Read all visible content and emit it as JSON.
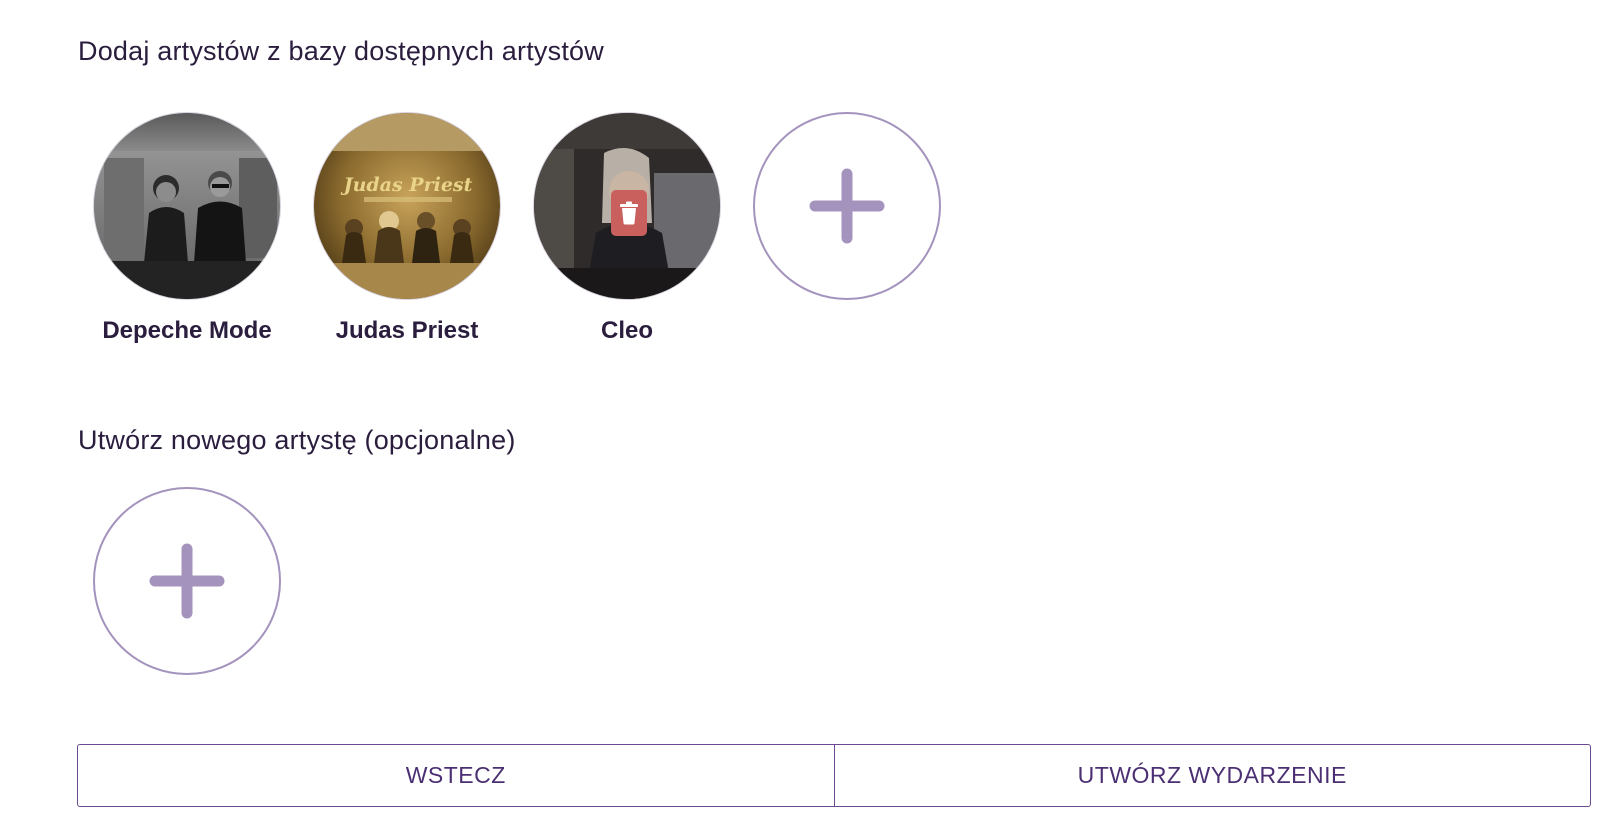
{
  "sections": {
    "existing_title": "Dodaj artystów z bazy dostępnych artystów",
    "new_title": "Utwórz nowego artystę (opcjonalne)"
  },
  "artists": [
    {
      "name": "Depeche Mode",
      "photo": "two-men-black-white-photo"
    },
    {
      "name": "Judas Priest",
      "photo": "band-golden-poster-photo"
    },
    {
      "name": "Cleo",
      "photo": "woman-dark-photo",
      "has_delete": true
    }
  ],
  "icons": {
    "add": "plus-icon",
    "delete": "trash-icon"
  },
  "buttons": {
    "back_label": "WSTECZ",
    "create_label": "UTWÓRZ WYDARZENIE"
  },
  "colors": {
    "accent": "#a493bd",
    "button_border": "#6b4a91",
    "button_text": "#4b2f73",
    "text": "#2a1d3d",
    "delete": "#c9605d"
  }
}
